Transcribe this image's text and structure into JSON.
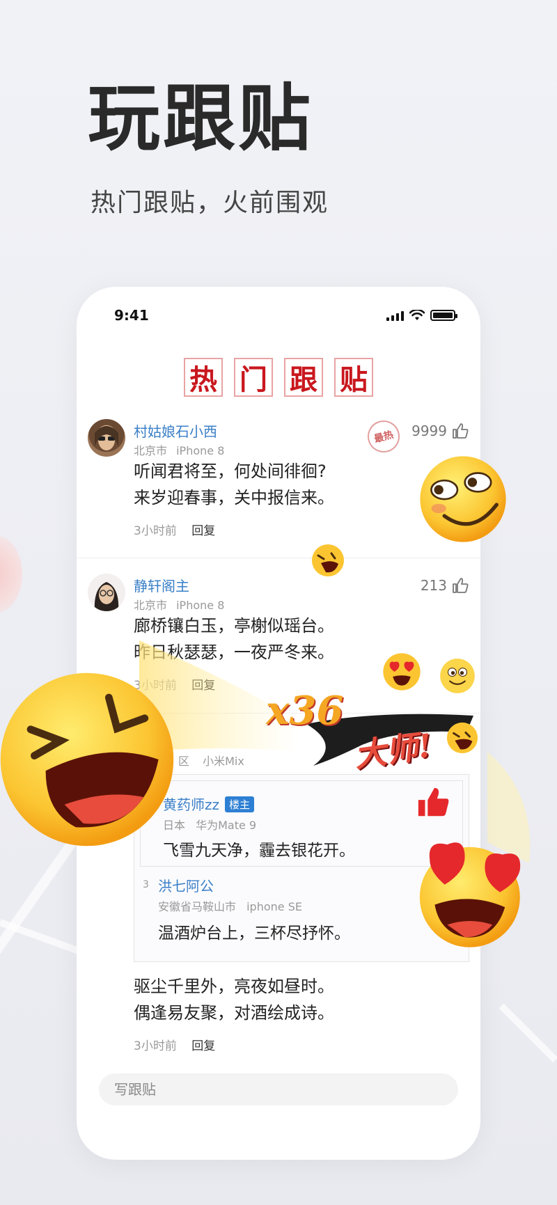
{
  "hero": {
    "title": "玩跟贴",
    "subtitle": "热门跟贴，火前围观"
  },
  "status_bar": {
    "time": "9:41"
  },
  "section_title": [
    "热",
    "门",
    "跟",
    "贴"
  ],
  "comments": [
    {
      "name": "村姑娘石小西",
      "location": "北京市",
      "device": "iPhone 8",
      "text_lines": [
        "听闻君将至，何处间徘徊?",
        "来岁迎春事，关中报信来。"
      ],
      "time": "3小时前",
      "reply": "回复",
      "likes": "9999",
      "hot_stamp": "最热"
    },
    {
      "name": "静轩阁主",
      "location": "北京市",
      "device": "iPhone 8",
      "text_lines": [
        "廊桥镶白玉，亭榭似瑶台。",
        "昨日秋瑟瑟，一夜严冬来。"
      ],
      "time": "3小时前",
      "reply": "回复",
      "likes": "213"
    },
    {
      "location": "区",
      "device": "小米Mix",
      "quotes": [
        {
          "name": "黄药师zz",
          "badge": "楼主",
          "location": "日本",
          "device": "华为Mate 9",
          "text": "飞雪九天净，霾去银花开。"
        },
        {
          "floor": "3",
          "name": "洪七阿公",
          "location": "安徽省马鞍山市",
          "device": "iphone SE",
          "text": "温酒炉台上，三杯尽抒怀。"
        }
      ],
      "text_lines": [
        "驱尘千里外，亮夜如昼时。",
        "偶逢易友聚，对酒绘成诗。"
      ],
      "time": "3小时前",
      "reply": "回复"
    }
  ],
  "combo": {
    "count": "x36",
    "title": "大师!"
  },
  "input": {
    "placeholder": "写跟贴"
  },
  "colors": {
    "accent_blue": "#3a7fc7",
    "seal_red": "#c9171e",
    "like_red": "#e5282b",
    "badge_blue": "#2d7fd3"
  }
}
